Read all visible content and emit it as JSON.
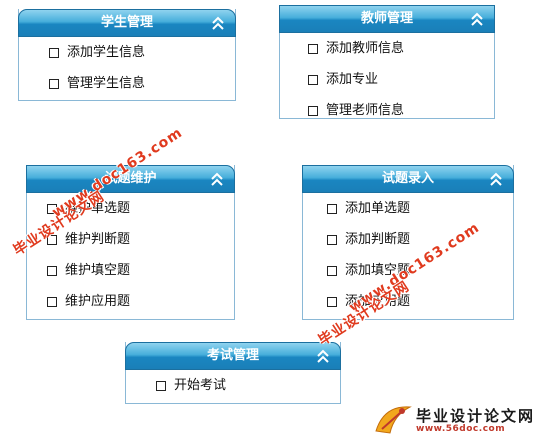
{
  "panels": [
    {
      "id": "student",
      "title": "学生管理",
      "items": [
        "添加学生信息",
        "管理学生信息"
      ]
    },
    {
      "id": "teacher",
      "title": "教师管理",
      "items": [
        "添加教师信息",
        "添加专业",
        "管理老师信息"
      ]
    },
    {
      "id": "maintain",
      "title": "试题维护",
      "items": [
        "维护单选题",
        "维护判断题",
        "维护填空题",
        "维护应用题"
      ]
    },
    {
      "id": "entry",
      "title": "试题录入",
      "items": [
        "添加单选题",
        "添加判断题",
        "添加填空题",
        "添加应用题"
      ]
    },
    {
      "id": "exam",
      "title": "考试管理",
      "items": [
        "开始考试"
      ]
    }
  ],
  "watermarks": {
    "site_name": "毕业设计论文网",
    "url": "www.doc163.com"
  },
  "logo": {
    "text": "毕业设计论文网",
    "url": "www.56doc.com"
  },
  "colors": {
    "header_top": "#8fd3ef",
    "header_bottom": "#1a7fb8",
    "panel_border": "#8ab8d6",
    "watermark": "#e03a1e"
  }
}
